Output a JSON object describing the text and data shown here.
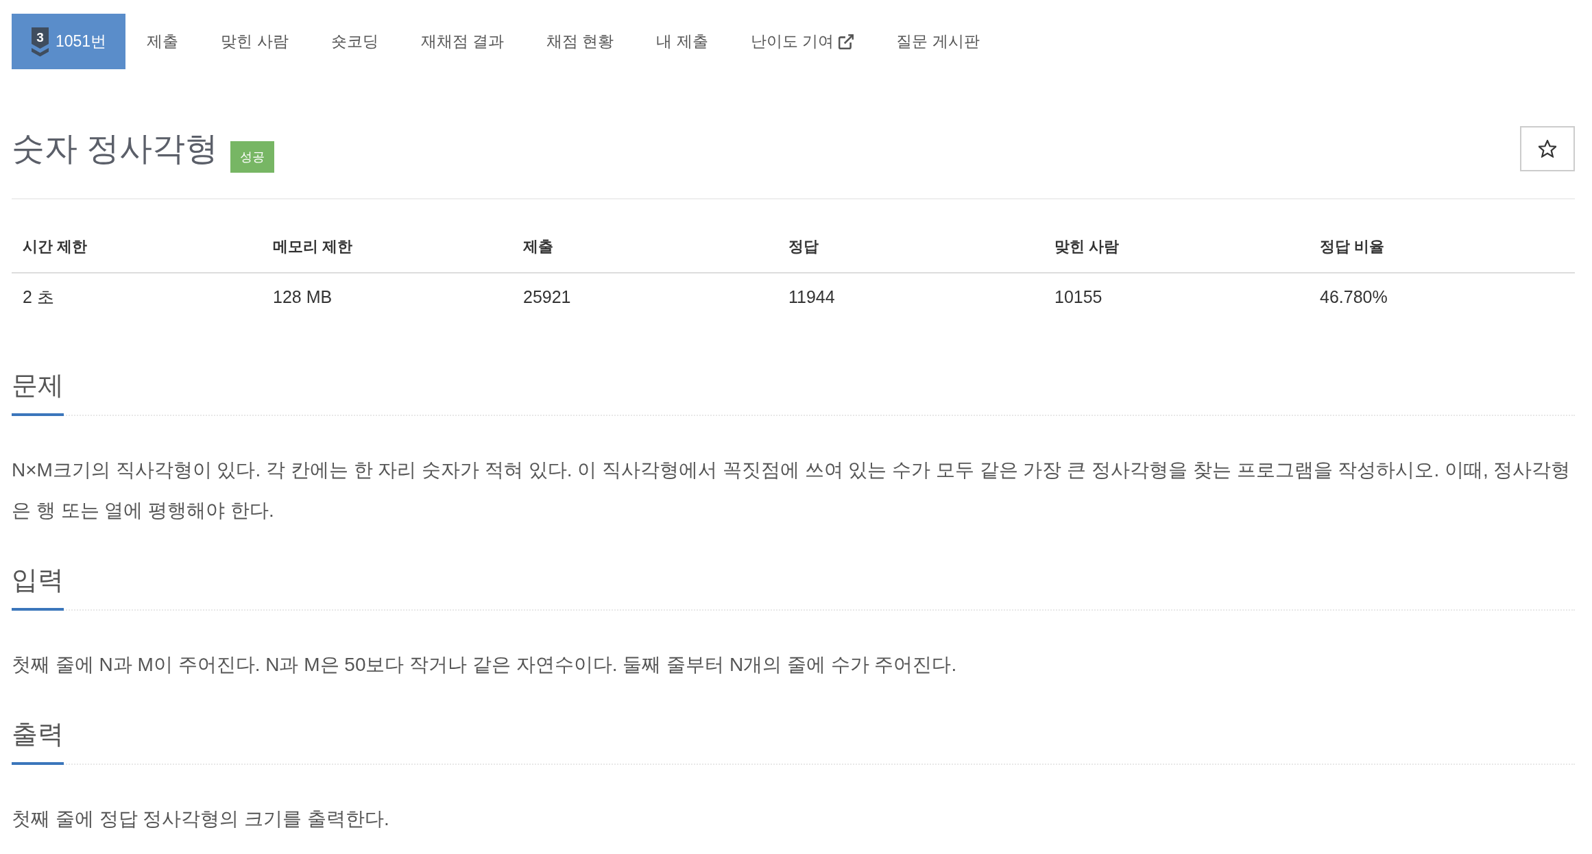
{
  "problem_nav": {
    "tabs": [
      {
        "label": "1051번",
        "tier": "3",
        "selected": true,
        "external": false
      },
      {
        "label": "제출",
        "selected": false,
        "external": false
      },
      {
        "label": "맞힌 사람",
        "selected": false,
        "external": false
      },
      {
        "label": "숏코딩",
        "selected": false,
        "external": false
      },
      {
        "label": "재채점 결과",
        "selected": false,
        "external": false
      },
      {
        "label": "채점 현황",
        "selected": false,
        "external": false
      },
      {
        "label": "내 제출",
        "selected": false,
        "external": false
      },
      {
        "label": "난이도 기여",
        "selected": false,
        "external": true
      },
      {
        "label": "질문 게시판",
        "selected": false,
        "external": false
      }
    ]
  },
  "title": "숫자 정사각형",
  "status_badge": "성공",
  "favorite": {
    "starred": false
  },
  "info_table": {
    "columns": [
      "시간 제한",
      "메모리 제한",
      "제출",
      "정답",
      "맞힌 사람",
      "정답 비율"
    ],
    "rows": [
      [
        "2 초",
        "128 MB",
        "25921",
        "11944",
        "10155",
        "46.780%"
      ]
    ]
  },
  "sections": [
    {
      "heading": "문제",
      "body": "N×M크기의 직사각형이 있다. 각 칸에는 한 자리 숫자가 적혀 있다. 이 직사각형에서 꼭짓점에 쓰여 있는 수가 모두 같은 가장 큰 정사각형을 찾는 프로그램을 작성하시오. 이때, 정사각형은 행 또는 열에 평행해야 한다."
    },
    {
      "heading": "입력",
      "body": "첫째 줄에 N과 M이 주어진다. N과 M은 50보다 작거나 같은 자연수이다. 둘째 줄부터 N개의 줄에 수가 주어진다."
    },
    {
      "heading": "출력",
      "body": "첫째 줄에 정답 정사각형의 크기를 출력한다."
    }
  ]
}
